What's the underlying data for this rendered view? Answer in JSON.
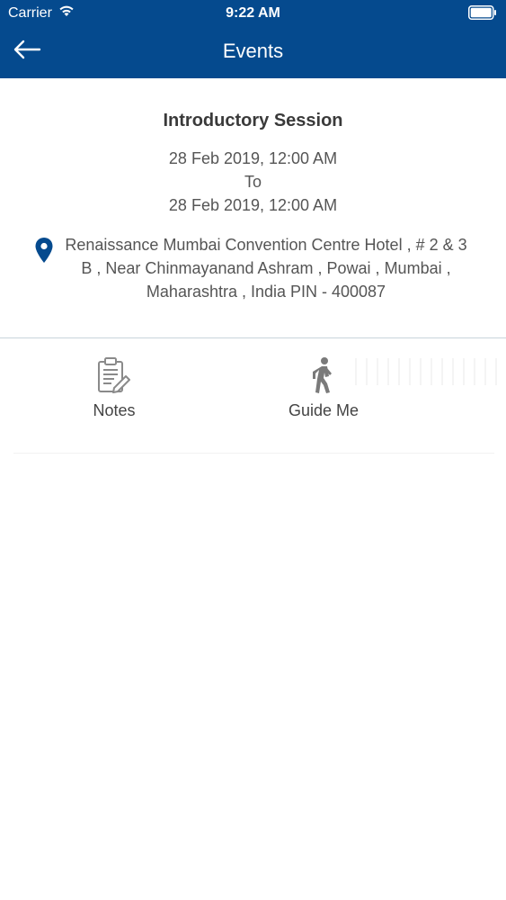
{
  "status_bar": {
    "carrier": "Carrier",
    "time": "9:22 AM"
  },
  "nav": {
    "title": "Events",
    "back_icon": "back-arrow-icon"
  },
  "event": {
    "title": "Introductory Session",
    "start": "28 Feb 2019, 12:00 AM",
    "separator": "To",
    "end": "28 Feb 2019, 12:00 AM",
    "address": "Renaissance Mumbai Convention Centre Hotel , # 2 & 3 B , Near Chinmayanand Ashram , Powai , Mumbai , Maharashtra , India PIN - 400087"
  },
  "actions": [
    {
      "label": "Notes",
      "icon": "notes-icon"
    },
    {
      "label": "Guide Me",
      "icon": "walking-person-icon"
    }
  ],
  "colors": {
    "header_bg": "#054a8e",
    "pin": "#054a8e",
    "text": "#555555"
  }
}
